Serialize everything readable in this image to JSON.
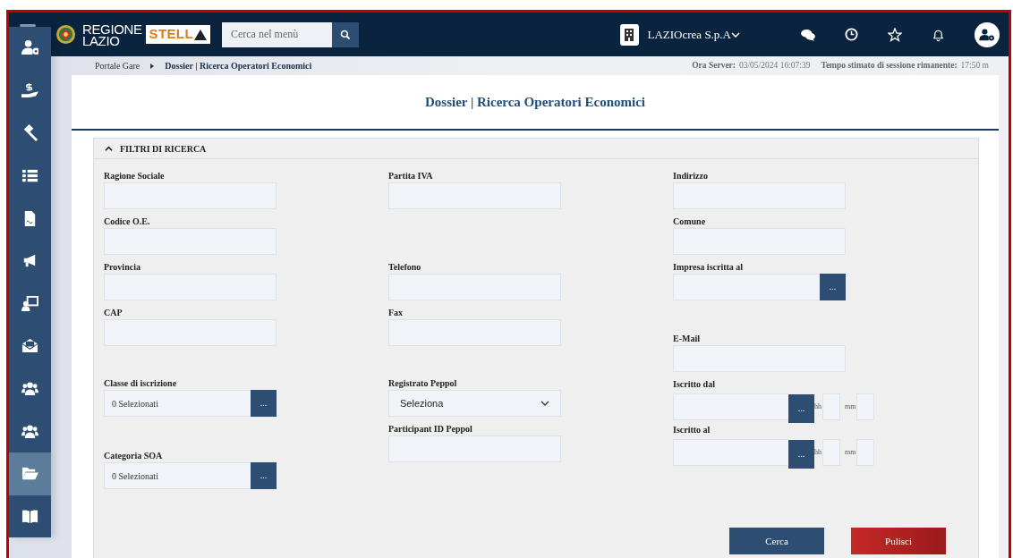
{
  "header": {
    "logo_lines": [
      "REGIONE",
      "LAZIO"
    ],
    "brand": "STELL",
    "search": {
      "placeholder": "Cerca nel menù"
    },
    "organization": "LAZIOcrea S.p.A"
  },
  "sidebar": {
    "items": [
      {
        "selected": false
      },
      {
        "selected": false
      },
      {
        "selected": false
      },
      {
        "selected": false
      },
      {
        "selected": false
      },
      {
        "selected": false
      },
      {
        "selected": false
      },
      {
        "selected": false
      },
      {
        "selected": false
      },
      {
        "selected": false
      },
      {
        "selected": true
      },
      {
        "selected": false
      }
    ]
  },
  "breadcrumb": [
    "Portale Gare",
    "Dossier | Ricerca Operatori Economici"
  ],
  "server_info": {
    "server_label": "Ora Server:",
    "server_time": "03/05/2024 16:07:39",
    "session_label": "Tempo stimato di sessione rimanente:",
    "session_time": "17:50 m"
  },
  "page_title": "Dossier | Ricerca Operatori Economici",
  "filters": {
    "title": "FILTRI DI RICERCA",
    "expanded": true,
    "columns": [
      [
        {
          "label": "Ragione Sociale",
          "kind": "text"
        },
        {
          "label": "Codice O.E.",
          "kind": "text"
        },
        {
          "label": "Provincia",
          "kind": "text"
        },
        {
          "label": "CAP",
          "kind": "text"
        },
        {
          "label": "Classe di iscrizione",
          "kind": "picker",
          "value": "0 Selezionati",
          "button": "..."
        },
        {
          "label": "Categoria SOA",
          "kind": "picker",
          "value": "0 Selezionati",
          "button": "..."
        }
      ],
      [
        {
          "label": "Partita IVA",
          "kind": "text"
        },
        {
          "label": "Telefono",
          "kind": "text"
        },
        {
          "label": "Fax",
          "kind": "text"
        },
        {
          "label": "Registrato Peppol",
          "kind": "select",
          "value": "Seleziona"
        },
        {
          "label": "Participant ID Peppol",
          "kind": "text"
        }
      ],
      [
        {
          "label": "Indirizzo",
          "kind": "text"
        },
        {
          "label": "Comune",
          "kind": "text"
        },
        {
          "label": "Impresa iscritta al",
          "kind": "picker",
          "button": "..."
        },
        {
          "label": "E-Mail",
          "kind": "text"
        },
        {
          "label": "Iscritto dal",
          "kind": "datetime",
          "button": "...",
          "hour_label": "hh",
          "minute_label": "mm"
        },
        {
          "label": "Iscritto al",
          "kind": "datetime",
          "button": "...",
          "hour_label": "hh",
          "minute_label": "mm"
        }
      ]
    ]
  },
  "buttons": [
    {
      "label": "Cerca",
      "kind": "primary"
    },
    {
      "label": "Pulisci",
      "kind": "danger"
    }
  ]
}
